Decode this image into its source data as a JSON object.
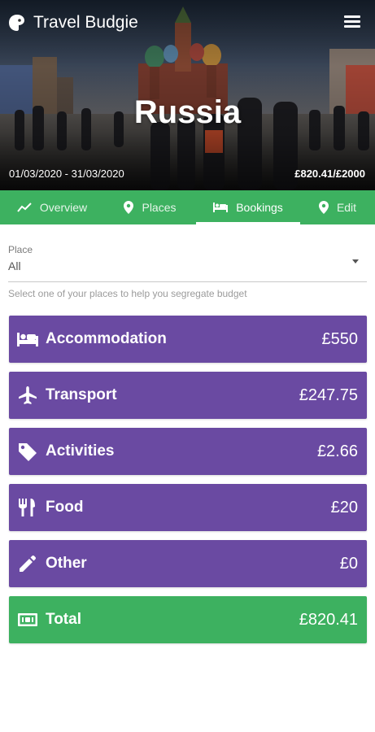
{
  "app": {
    "title": "Travel Budgie"
  },
  "trip": {
    "name": "Russia",
    "date_range": "01/03/2020 - 31/03/2020",
    "budget_summary": "£820.41/£2000"
  },
  "tabs": [
    {
      "label": "Overview",
      "icon": "trending-up-icon"
    },
    {
      "label": "Places",
      "icon": "map-pin-icon"
    },
    {
      "label": "Bookings",
      "icon": "bed-icon",
      "active": true
    },
    {
      "label": "Edit",
      "icon": "map-pin-icon"
    }
  ],
  "filter": {
    "label": "Place",
    "value": "All",
    "hint": "Select one of your places to help you segregate budget"
  },
  "categories": [
    {
      "label": "Accommodation",
      "amount": "£550",
      "icon": "bed-icon"
    },
    {
      "label": "Transport",
      "amount": "£247.75",
      "icon": "airplane-icon"
    },
    {
      "label": "Activities",
      "amount": "£2.66",
      "icon": "tag-icon"
    },
    {
      "label": "Food",
      "amount": "£20",
      "icon": "fork-knife-icon"
    },
    {
      "label": "Other",
      "amount": "£0",
      "icon": "pencil-icon"
    }
  ],
  "total": {
    "label": "Total",
    "amount": "£820.41",
    "icon": "money-icon"
  },
  "colors": {
    "brand_green": "#3db160",
    "category_purple": "#6a4aa2",
    "text_white": "#ffffff"
  }
}
